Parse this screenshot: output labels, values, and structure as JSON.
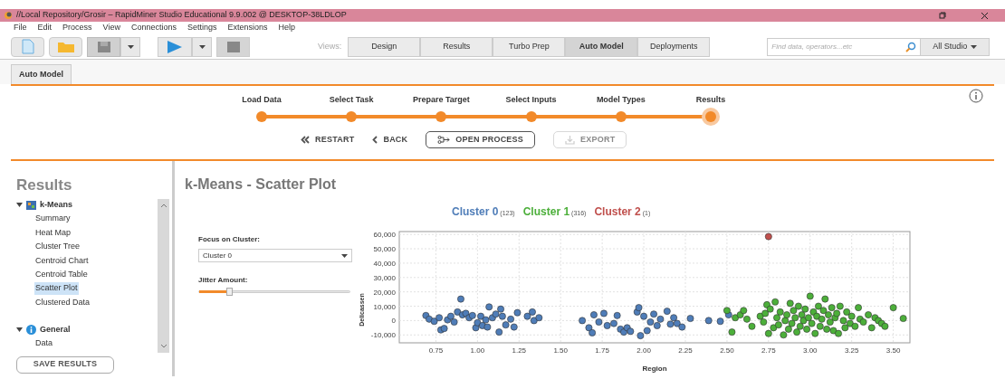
{
  "window": {
    "title": "//Local Repository/Grosir – RapidMiner Studio Educational 9.9.002 @ DESKTOP-38LDLOP"
  },
  "menu": [
    "File",
    "Edit",
    "Process",
    "View",
    "Connections",
    "Settings",
    "Extensions",
    "Help"
  ],
  "views": {
    "label": "Views:",
    "tabs": [
      {
        "label": "Design",
        "selected": false
      },
      {
        "label": "Results",
        "selected": false
      },
      {
        "label": "Turbo Prep",
        "selected": false
      },
      {
        "label": "Auto Model",
        "selected": true
      },
      {
        "label": "Deployments",
        "selected": false
      }
    ]
  },
  "search": {
    "placeholder": "Find data, operators...etc"
  },
  "scope": "All Studio",
  "doc_tab": "Auto Model",
  "steps": [
    {
      "label": "Load Data",
      "selected": false
    },
    {
      "label": "Select Task",
      "selected": false
    },
    {
      "label": "Prepare Target",
      "selected": false
    },
    {
      "label": "Select Inputs",
      "selected": false
    },
    {
      "label": "Model Types",
      "selected": false
    },
    {
      "label": "Results",
      "selected": true
    }
  ],
  "actions": [
    {
      "kind": "restart",
      "label": "RESTART",
      "disabled": false
    },
    {
      "kind": "back",
      "label": "BACK",
      "disabled": false
    },
    {
      "kind": "open",
      "label": "OPEN PROCESS",
      "disabled": false
    },
    {
      "kind": "export",
      "label": "EXPORT",
      "disabled": true
    }
  ],
  "sidebar": {
    "title": "Results",
    "tree": [
      {
        "label": "k-Means",
        "kind": "model",
        "expanded": true,
        "children": [
          {
            "label": "Summary",
            "selected": false
          },
          {
            "label": "Heat Map",
            "selected": false
          },
          {
            "label": "Cluster Tree",
            "selected": false
          },
          {
            "label": "Centroid Chart",
            "selected": false
          },
          {
            "label": "Centroid Table",
            "selected": false
          },
          {
            "label": "Scatter Plot",
            "selected": true
          },
          {
            "label": "Clustered Data",
            "selected": false
          }
        ]
      },
      {
        "label": "General",
        "kind": "info",
        "expanded": true,
        "children": [
          {
            "label": "Data",
            "selected": false
          }
        ]
      }
    ],
    "save_button": "SAVE RESULTS"
  },
  "main": {
    "title": "k-Means - Scatter Plot",
    "focus_label": "Focus on Cluster:",
    "focus_value": "Cluster 0",
    "jitter_label": "Jitter Amount:",
    "jitter": {
      "level": 0.2
    },
    "legend_counts": [
      "(123)",
      "(316)",
      "(1)"
    ],
    "chart_data": {
      "type": "scatter",
      "xlabel": "Region",
      "ylabel": "Delicassen",
      "xlim": [
        0.53,
        3.6
      ],
      "ylim": [
        -15500,
        62000
      ],
      "grid": true,
      "xticks": [
        {
          "value": 0.75,
          "label": "0.75"
        },
        {
          "value": 1,
          "label": "1.00"
        },
        {
          "value": 1.25,
          "label": "1.25"
        },
        {
          "value": 1.5,
          "label": "1.50"
        },
        {
          "value": 1.75,
          "label": "1.75"
        },
        {
          "value": 2,
          "label": "2.00"
        },
        {
          "value": 2.25,
          "label": "2.25"
        },
        {
          "value": 2.5,
          "label": "2.50"
        },
        {
          "value": 2.75,
          "label": "2.75"
        },
        {
          "value": 3,
          "label": "3.00"
        },
        {
          "value": 3.25,
          "label": "3.25"
        },
        {
          "value": 3.5,
          "label": "3.50"
        }
      ],
      "yticks": [
        {
          "value": -10000,
          "label": "-10,000"
        },
        {
          "value": 0,
          "label": "0"
        },
        {
          "value": 10000,
          "label": "10,000"
        },
        {
          "value": 20000,
          "label": "20,000"
        },
        {
          "value": 30000,
          "label": "30,000"
        },
        {
          "value": 40000,
          "label": "40,000"
        },
        {
          "value": 50000,
          "label": "50,000"
        },
        {
          "value": 60000,
          "label": "60,000"
        }
      ],
      "series": [
        {
          "name": "Cluster 0",
          "color": "#4f7db8",
          "x": [
            0.69,
            0.71,
            0.74,
            0.77,
            0.78,
            0.8,
            0.82,
            0.84,
            0.86,
            0.88,
            0.9,
            0.91,
            0.93,
            0.95,
            0.97,
            0.99,
            1.0,
            1.02,
            1.03,
            1.05,
            1.06,
            1.07,
            1.09,
            1.11,
            1.13,
            1.14,
            1.15,
            1.17,
            1.2,
            1.22,
            1.24,
            1.3,
            1.33,
            1.34,
            1.37,
            1.63,
            1.67,
            1.69,
            1.7,
            1.73,
            1.76,
            1.78,
            1.82,
            1.84,
            1.86,
            1.88,
            1.9,
            1.92,
            1.96,
            1.97,
            1.98,
            2.0,
            2.02,
            2.04,
            2.06,
            2.08,
            2.1,
            2.14,
            2.16,
            2.18,
            2.2,
            2.23,
            2.28,
            2.39,
            2.46,
            2.51
          ],
          "values": [
            3500,
            1000,
            -500,
            2000,
            -6500,
            -5500,
            500,
            3000,
            -1000,
            6000,
            15000,
            4000,
            5000,
            2000,
            3500,
            -5000,
            -1500,
            3000,
            -3500,
            500,
            -4500,
            9500,
            2000,
            4500,
            -8000,
            8000,
            3000,
            -3000,
            1000,
            -4500,
            5500,
            3000,
            6000,
            0,
            2000,
            0,
            -5000,
            -8500,
            4000,
            -1000,
            5000,
            -3500,
            -2000,
            3500,
            -6000,
            -8000,
            -5000,
            -7500,
            6000,
            9000,
            -10500,
            3000,
            -7000,
            -1000,
            4500,
            -3500,
            1000,
            6500,
            -2500,
            2000,
            -2000,
            -4500,
            1500,
            0,
            -500,
            4000
          ]
        },
        {
          "name": "Cluster 1",
          "color": "#4caf3a",
          "x": [
            2.5,
            2.53,
            2.55,
            2.58,
            2.6,
            2.62,
            2.65,
            2.7,
            2.72,
            2.73,
            2.74,
            2.75,
            2.76,
            2.78,
            2.79,
            2.8,
            2.81,
            2.82,
            2.84,
            2.85,
            2.86,
            2.87,
            2.88,
            2.89,
            2.9,
            2.91,
            2.92,
            2.93,
            2.94,
            2.95,
            2.96,
            2.97,
            2.98,
            2.99,
            3.0,
            3.01,
            3.02,
            3.03,
            3.04,
            3.05,
            3.06,
            3.07,
            3.08,
            3.09,
            3.1,
            3.11,
            3.12,
            3.13,
            3.14,
            3.15,
            3.16,
            3.17,
            3.18,
            3.2,
            3.21,
            3.22,
            3.24,
            3.25,
            3.27,
            3.29,
            3.3,
            3.32,
            3.35,
            3.37,
            3.39,
            3.41,
            3.43,
            3.45,
            3.5,
            3.56
          ],
          "values": [
            7000,
            -8000,
            2000,
            4000,
            7000,
            1000,
            -4000,
            3000,
            -1000,
            5000,
            11000,
            -9000,
            8000,
            -5000,
            13000,
            2000,
            -3000,
            6000,
            -10000,
            0,
            4000,
            -6000,
            12000,
            -2000,
            7000,
            2000,
            -8000,
            10000,
            -4000,
            4000,
            0,
            8000,
            -6000,
            2000,
            17000,
            -2000,
            6000,
            -9000,
            3000,
            10000,
            -4000,
            1000,
            7000,
            15000,
            -6000,
            4000,
            -1000,
            9000,
            -7000,
            2000,
            5000,
            -9000,
            10000,
            0,
            -5000,
            6000,
            -2000,
            3000,
            -4000,
            9000,
            1000,
            -1000,
            4000,
            -5000,
            2000,
            0,
            -2000,
            -4000,
            9000,
            1500
          ]
        },
        {
          "name": "Cluster 2",
          "color": "#c0504d",
          "x": [
            2.75
          ],
          "values": [
            58500
          ]
        }
      ]
    }
  }
}
